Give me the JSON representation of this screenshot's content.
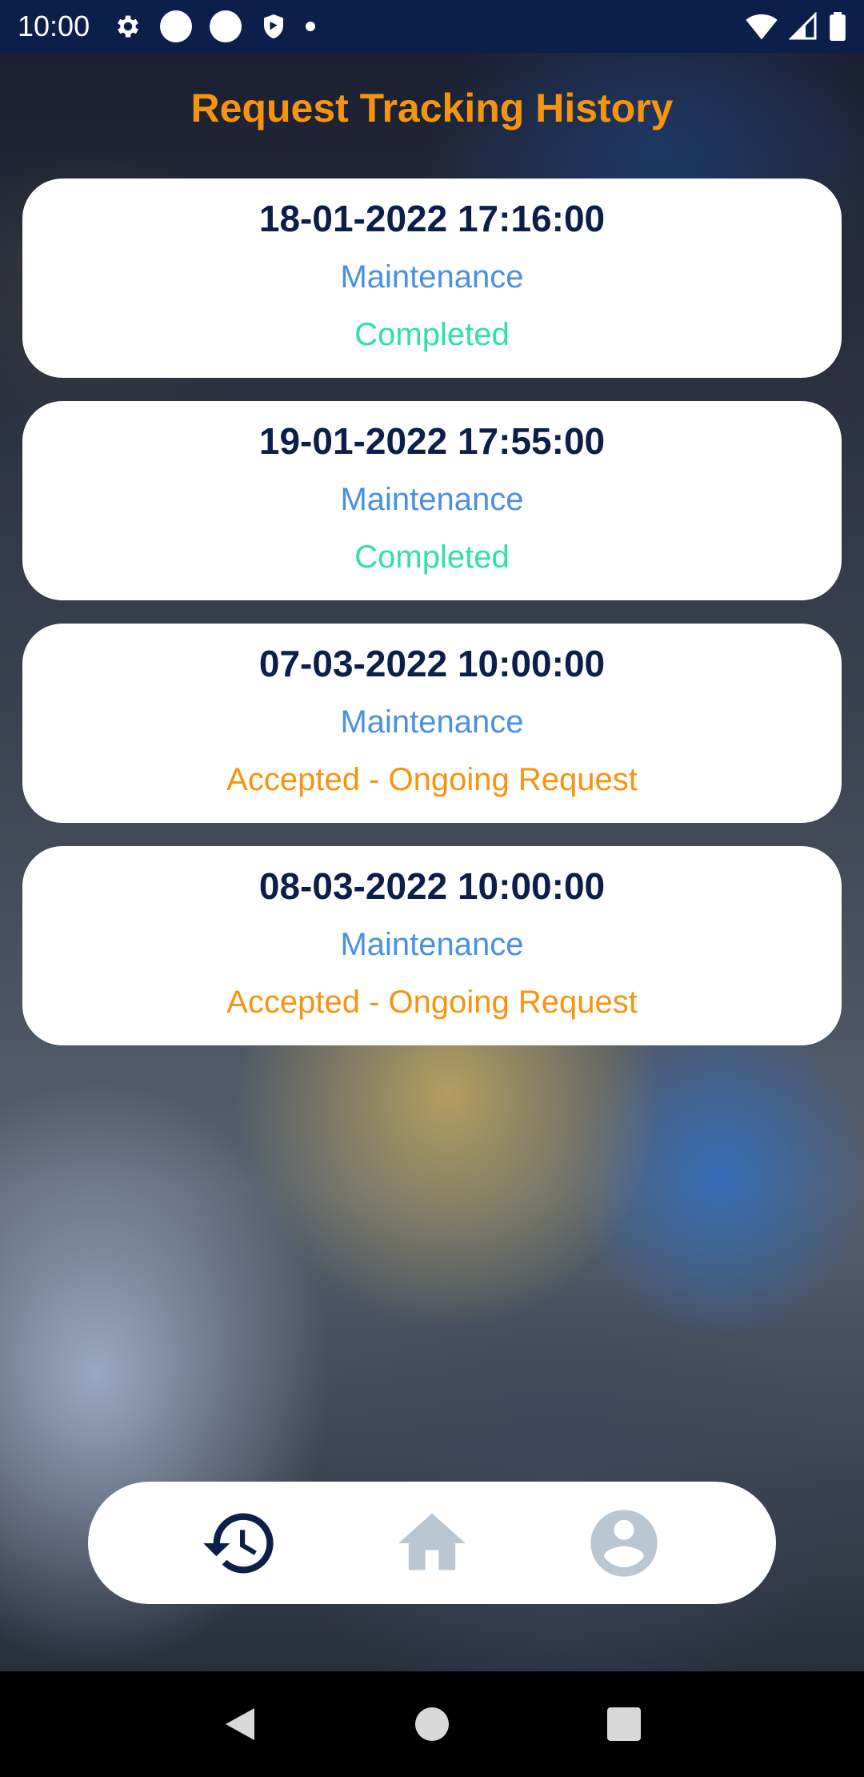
{
  "status_bar": {
    "time": "10:00"
  },
  "header": {
    "title": "Request Tracking History"
  },
  "requests": [
    {
      "datetime": "18-01-2022 17:16:00",
      "type": "Maintenance",
      "status": "Completed",
      "status_color": "#2fe0a7"
    },
    {
      "datetime": "19-01-2022 17:55:00",
      "type": "Maintenance",
      "status": "Completed",
      "status_color": "#2fe0a7"
    },
    {
      "datetime": "07-03-2022 10:00:00",
      "type": "Maintenance",
      "status": "Accepted - Ongoing Request",
      "status_color": "#f7940f"
    },
    {
      "datetime": "08-03-2022 10:00:00",
      "type": "Maintenance",
      "status": "Accepted - Ongoing Request",
      "status_color": "#f7940f"
    }
  ],
  "bottom_nav": {
    "items": [
      {
        "icon": "history-icon",
        "active": true
      },
      {
        "icon": "home-icon",
        "active": false
      },
      {
        "icon": "profile-icon",
        "active": false
      }
    ]
  },
  "colors": {
    "primary": "#0c1f4a",
    "accent": "#f7940f",
    "link": "#4a90e2",
    "inactive_icon": "#b8c7d2"
  }
}
